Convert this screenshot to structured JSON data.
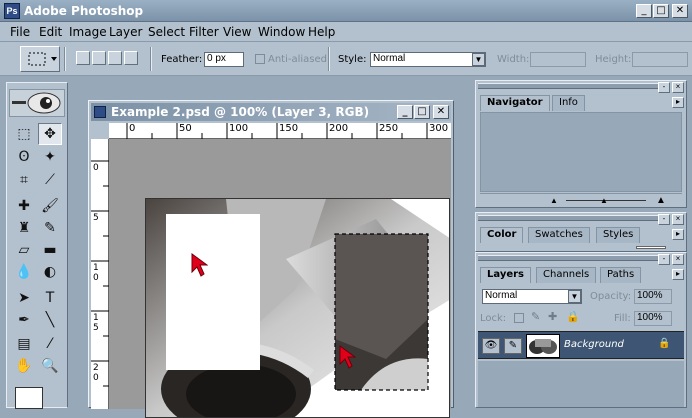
{
  "app": {
    "title": "Adobe Photoshop",
    "icon": "photoshop-app-icon"
  },
  "window_controls": {
    "minimize": "_",
    "maximize": "□",
    "close": "✕"
  },
  "menu": [
    "File",
    "Edit",
    "Image",
    "Layer",
    "Select",
    "Filter",
    "View",
    "Window",
    "Help"
  ],
  "options": {
    "feather_label": "Feather:",
    "feather_value": "0 px",
    "antialias_label": "Anti-aliased",
    "style_label": "Style:",
    "style_value": "Normal",
    "width_label": "Width:",
    "height_label": "Height:"
  },
  "document": {
    "title": "Example 2.psd @ 100% (Layer 3, RGB)",
    "ruler_h": [
      "0",
      "50",
      "100",
      "150",
      "200",
      "250",
      "300"
    ],
    "ruler_v": [
      "0",
      "5",
      "1 0",
      "1 5",
      "2 0"
    ]
  },
  "navigator": {
    "tabs": [
      "Navigator",
      "Info"
    ]
  },
  "color_panel": {
    "tabs": [
      "Color",
      "Swatches",
      "Styles"
    ]
  },
  "layers_panel": {
    "tabs": [
      "Layers",
      "Channels",
      "Paths"
    ],
    "blend_mode": "Normal",
    "opacity_label": "Opacity:",
    "opacity_value": "100%",
    "lock_label": "Lock:",
    "fill_label": "Fill:",
    "fill_value": "100%",
    "layer_name": "Background"
  },
  "colors": {
    "accent": "#2e4c86",
    "cursor": "#e0001a",
    "desktop": "#97a8b8"
  }
}
